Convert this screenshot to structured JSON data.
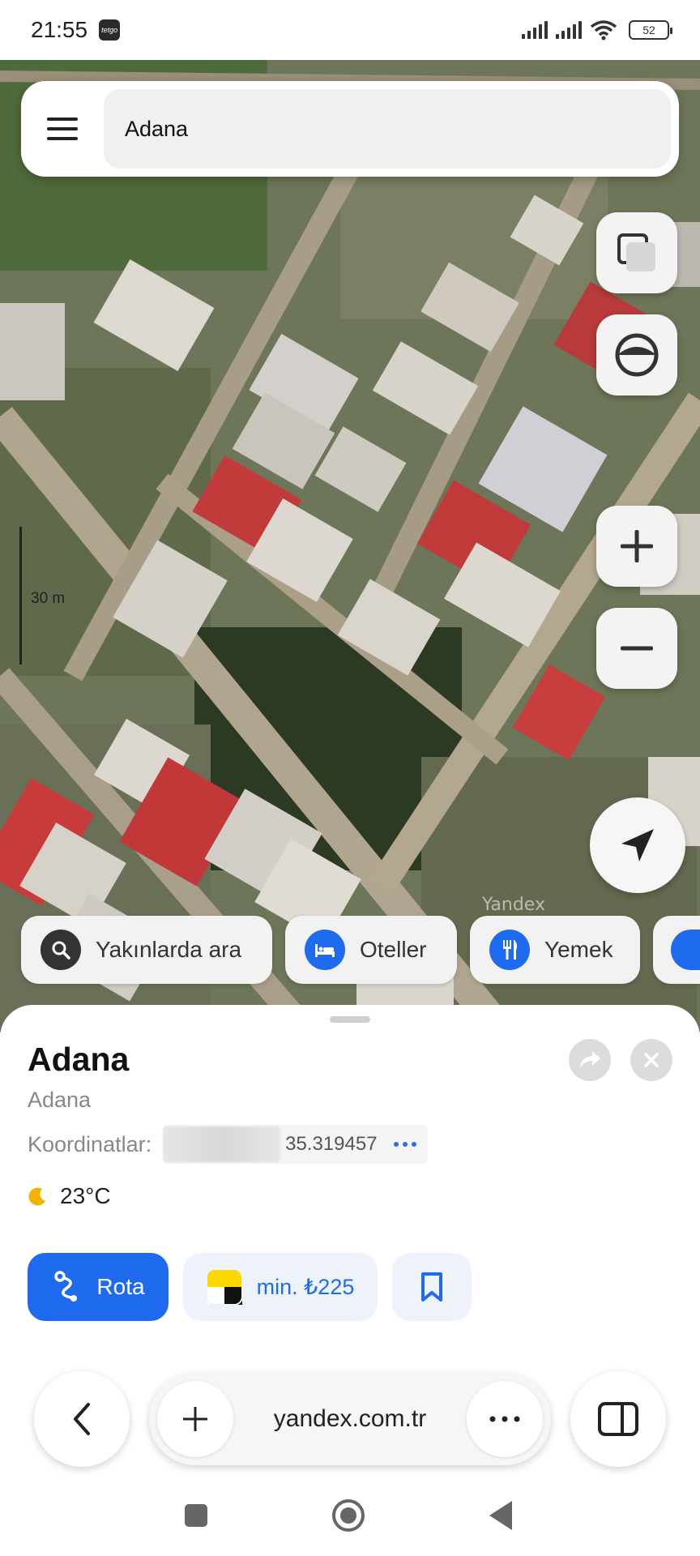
{
  "status_bar": {
    "time": "21:55",
    "app_icon_text": "tetgo",
    "battery": "52"
  },
  "search": {
    "value": "Adana"
  },
  "map": {
    "scale_label": "30 m",
    "watermark": "Yandex",
    "buttons": {
      "layers_icon": "layers-icon",
      "panorama_icon": "panorama-icon",
      "zoom_in_icon": "plus-icon",
      "zoom_out_icon": "minus-icon",
      "locate_icon": "navigation-arrow-icon"
    },
    "chips": [
      {
        "label": "Yakınlarda ara",
        "icon": "search-icon"
      },
      {
        "label": "Oteller",
        "icon": "bed-icon"
      },
      {
        "label": "Yemek",
        "icon": "fork-knife-icon"
      }
    ]
  },
  "place": {
    "title": "Adana",
    "subtitle": "Adana",
    "coords_label": "Koordinatlar:",
    "coords_value": "35.319457",
    "temperature": "23°C"
  },
  "actions": {
    "route_label": "Rota",
    "taxi_label": "min. ₺225"
  },
  "browser": {
    "url": "yandex.com.tr"
  },
  "colors": {
    "accent": "#1e6bf0",
    "chip_bg": "#f2f2f2",
    "sheet_bg": "#ffffff"
  }
}
